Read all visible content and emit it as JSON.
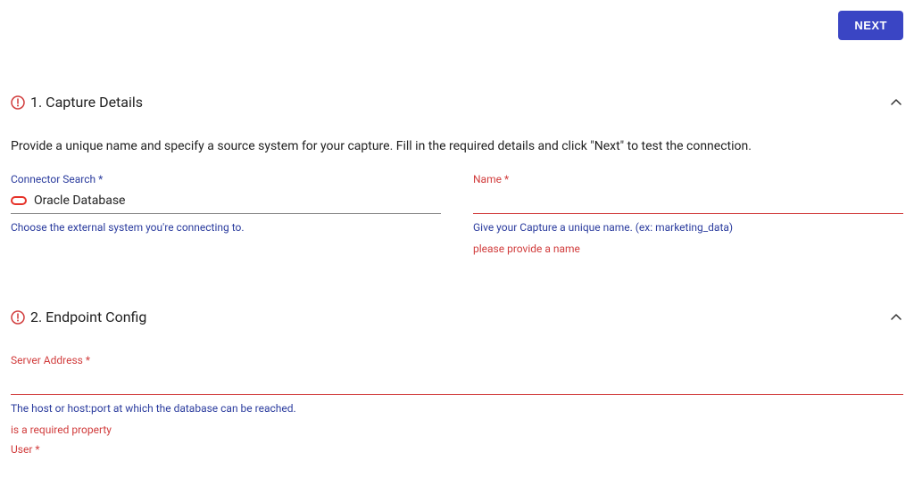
{
  "top": {
    "next_label": "NEXT"
  },
  "section1": {
    "title": "1. Capture Details",
    "description": "Provide a unique name and specify a source system for your capture. Fill in the required details and click \"Next\" to test the connection.",
    "connector": {
      "label": "Connector Search *",
      "value": "Oracle Database",
      "helper": "Choose the external system you're connecting to."
    },
    "name_field": {
      "label": "Name *",
      "helper": "Give your Capture a unique name. (ex: marketing_data)",
      "error": "please provide a name"
    }
  },
  "section2": {
    "title": "2. Endpoint Config",
    "server_address": {
      "label": "Server Address *",
      "helper": "The host or host:port at which the database can be reached.",
      "error": "is a required property"
    },
    "user_field": {
      "label": "User *"
    }
  }
}
